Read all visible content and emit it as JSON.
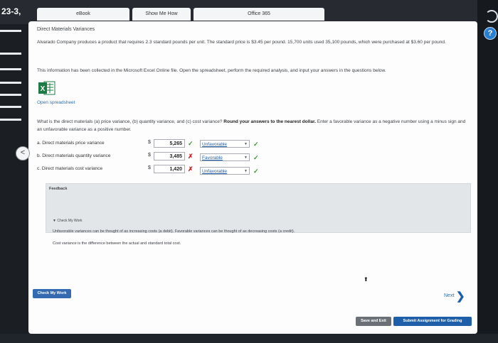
{
  "header": {
    "question_number": "23-3,",
    "tabs": [
      "eBook",
      "Show Me How",
      "Office 365"
    ]
  },
  "content": {
    "title": "Direct Materials Variances",
    "problem_text": "Alvarado Company produces a product that requires 2.3 standard pounds per unit. The standard price is $3.45 per pound. 15,700 units used 35,100 pounds, which were purchased at $3.60 per pound.",
    "info_text": "This information has been collected in the Microsoft Excel Online file. Open the spreadsheet, perform the required analysis, and input your answers in the questions below.",
    "open_spreadsheet_label": "Open spreadsheet",
    "question_text_start": "What is the direct materials (a) price variance, (b) quantity variance, and (c) cost variance?",
    "question_text_bold": "Round your answers to the nearest dollar.",
    "question_text_end": "Enter a favorable variance as a negative number using a minus sign and an unfavorable variance as a positive number.",
    "rows": [
      {
        "label": "a.  Direct materials price variance",
        "currency": "$",
        "value": "5,265",
        "mark": "✓",
        "status": "Unfavorable",
        "status_mark": "✓"
      },
      {
        "label": "b.  Direct materials quantity variance",
        "currency": "$",
        "value": "3,485",
        "mark": "✗",
        "status": "Favorable",
        "status_mark": "✓"
      },
      {
        "label": "c.  Direct materials cost variance",
        "currency": "$",
        "value": "1,420",
        "mark": "✗",
        "status": "Unfavorable",
        "status_mark": "✓"
      }
    ]
  },
  "feedback": {
    "title": "Feedback",
    "check_my_work": "Check My Work",
    "line1": "Unfavorable variances can be thought of as increasing costs (a debit). Favorable variances can be thought of as decreasing costs (a credit).",
    "line2": "Cost variance is the difference between the actual and standard total cost."
  },
  "footer": {
    "check_button": "Check My Work",
    "next_label": "Next",
    "save_button": "Save and Exit",
    "submit_button": "Submit Assignment for Grading"
  },
  "colors": {
    "accent": "#1f5ea8",
    "correct": "#3a9a2e",
    "incorrect": "#d11f2a",
    "excel_green": "#1e7b45"
  },
  "icons": [
    "help-icon",
    "back-arrow-icon",
    "excel-icon",
    "next-arrow-icon",
    "check-icon",
    "x-icon"
  ]
}
